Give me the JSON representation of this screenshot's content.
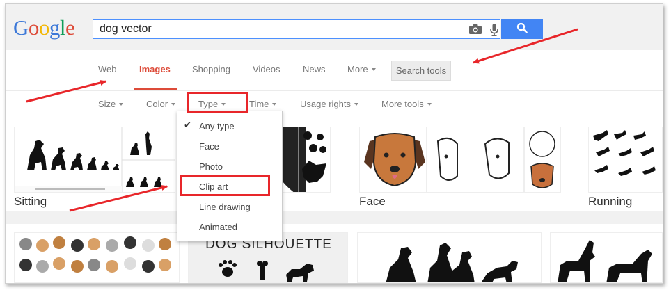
{
  "search": {
    "query": "dog vector"
  },
  "logo": {
    "letters": [
      "G",
      "o",
      "o",
      "g",
      "l",
      "e"
    ]
  },
  "nav": {
    "tabs": [
      {
        "label": "Web",
        "active": false
      },
      {
        "label": "Images",
        "active": true
      },
      {
        "label": "Shopping",
        "active": false
      },
      {
        "label": "Videos",
        "active": false
      },
      {
        "label": "News",
        "active": false
      },
      {
        "label": "More",
        "active": false
      }
    ],
    "search_tools": "Search tools"
  },
  "filters": [
    "Size",
    "Color",
    "Type",
    "Time",
    "Usage rights",
    "More tools"
  ],
  "type_menu": {
    "items": [
      {
        "label": "Any type",
        "checked": true
      },
      {
        "label": "Face",
        "checked": false
      },
      {
        "label": "Photo",
        "checked": false
      },
      {
        "label": "Clip art",
        "checked": false
      },
      {
        "label": "Line drawing",
        "checked": false
      },
      {
        "label": "Animated",
        "checked": false
      }
    ]
  },
  "results": {
    "categories": [
      "Sitting",
      "Face",
      "Running"
    ],
    "banner_text": "DOG SILHOUETTE"
  },
  "colors": {
    "accent_red": "#dd4b39",
    "search_blue": "#4285f4",
    "annotation_red": "#e8262a"
  }
}
